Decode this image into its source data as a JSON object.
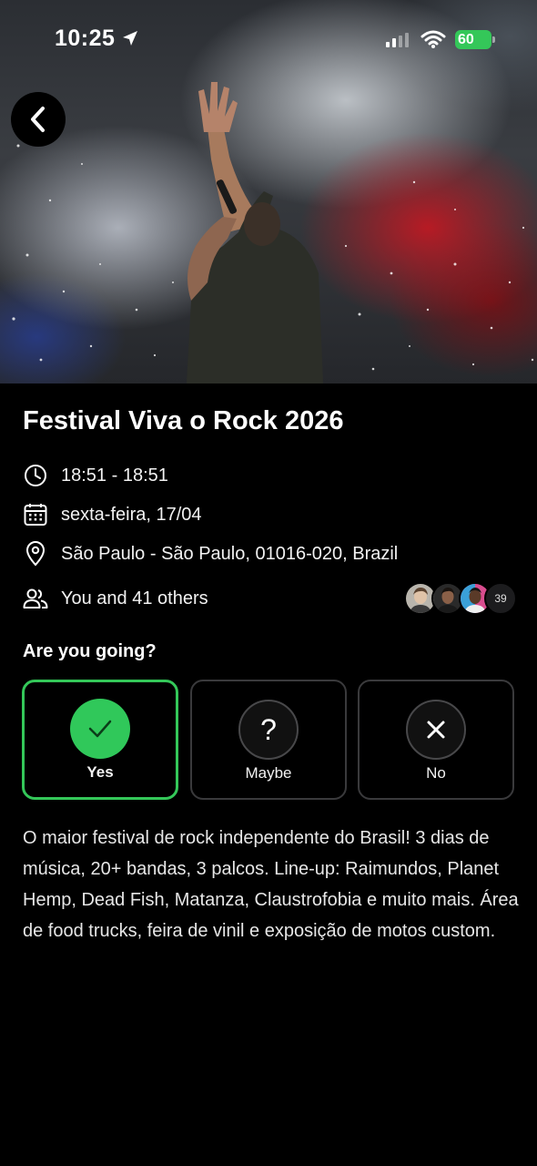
{
  "status_bar": {
    "time": "10:25",
    "battery": "60",
    "icons": [
      "location-arrow-icon",
      "signal-icon",
      "wifi-icon",
      "battery-icon"
    ]
  },
  "event": {
    "title": "Festival Viva o Rock 2026",
    "time_range": "18:51 - 18:51",
    "date": "sexta-feira, 17/04",
    "location": "São Paulo - São Paulo, 01016-020, Brazil",
    "attendees_text": "You and 41 others",
    "extra_attendees_count": "39",
    "description": "O maior festival de rock independente do Brasil! 3 dias de música, 20+ bandas, 3 palcos. Line-up: Raimundos, Planet Hemp, Dead Fish, Matanza, Claustrofobia e muito mais. Área de food trucks, feira de vinil e exposição de motos custom."
  },
  "rsvp": {
    "question": "Are you going?",
    "options": [
      {
        "label": "Yes",
        "icon": "check-icon",
        "selected": true
      },
      {
        "label": "Maybe",
        "icon": "question-icon",
        "selected": false
      },
      {
        "label": "No",
        "icon": "close-icon",
        "selected": false
      }
    ]
  },
  "colors": {
    "accent_green": "#34c759",
    "background": "#000000",
    "card_border": "#3a3a3c"
  }
}
